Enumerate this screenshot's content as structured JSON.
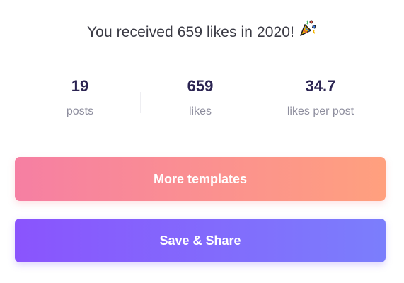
{
  "header": {
    "message": "You received 659 likes in 2020!",
    "icon": "party-popper-icon"
  },
  "stats": [
    {
      "value": "19",
      "label": "posts"
    },
    {
      "value": "659",
      "label": "likes"
    },
    {
      "value": "34.7",
      "label": "likes per post"
    }
  ],
  "actions": {
    "templates_label": "More templates",
    "share_label": "Save & Share"
  },
  "colors": {
    "stat_value": "#2b2452",
    "stat_label": "#8e8e9e",
    "templates_gradient_start": "#f67fa3",
    "templates_gradient_end": "#ffa07e",
    "share_gradient_start": "#8a54fd",
    "share_gradient_end": "#7b7efc"
  }
}
